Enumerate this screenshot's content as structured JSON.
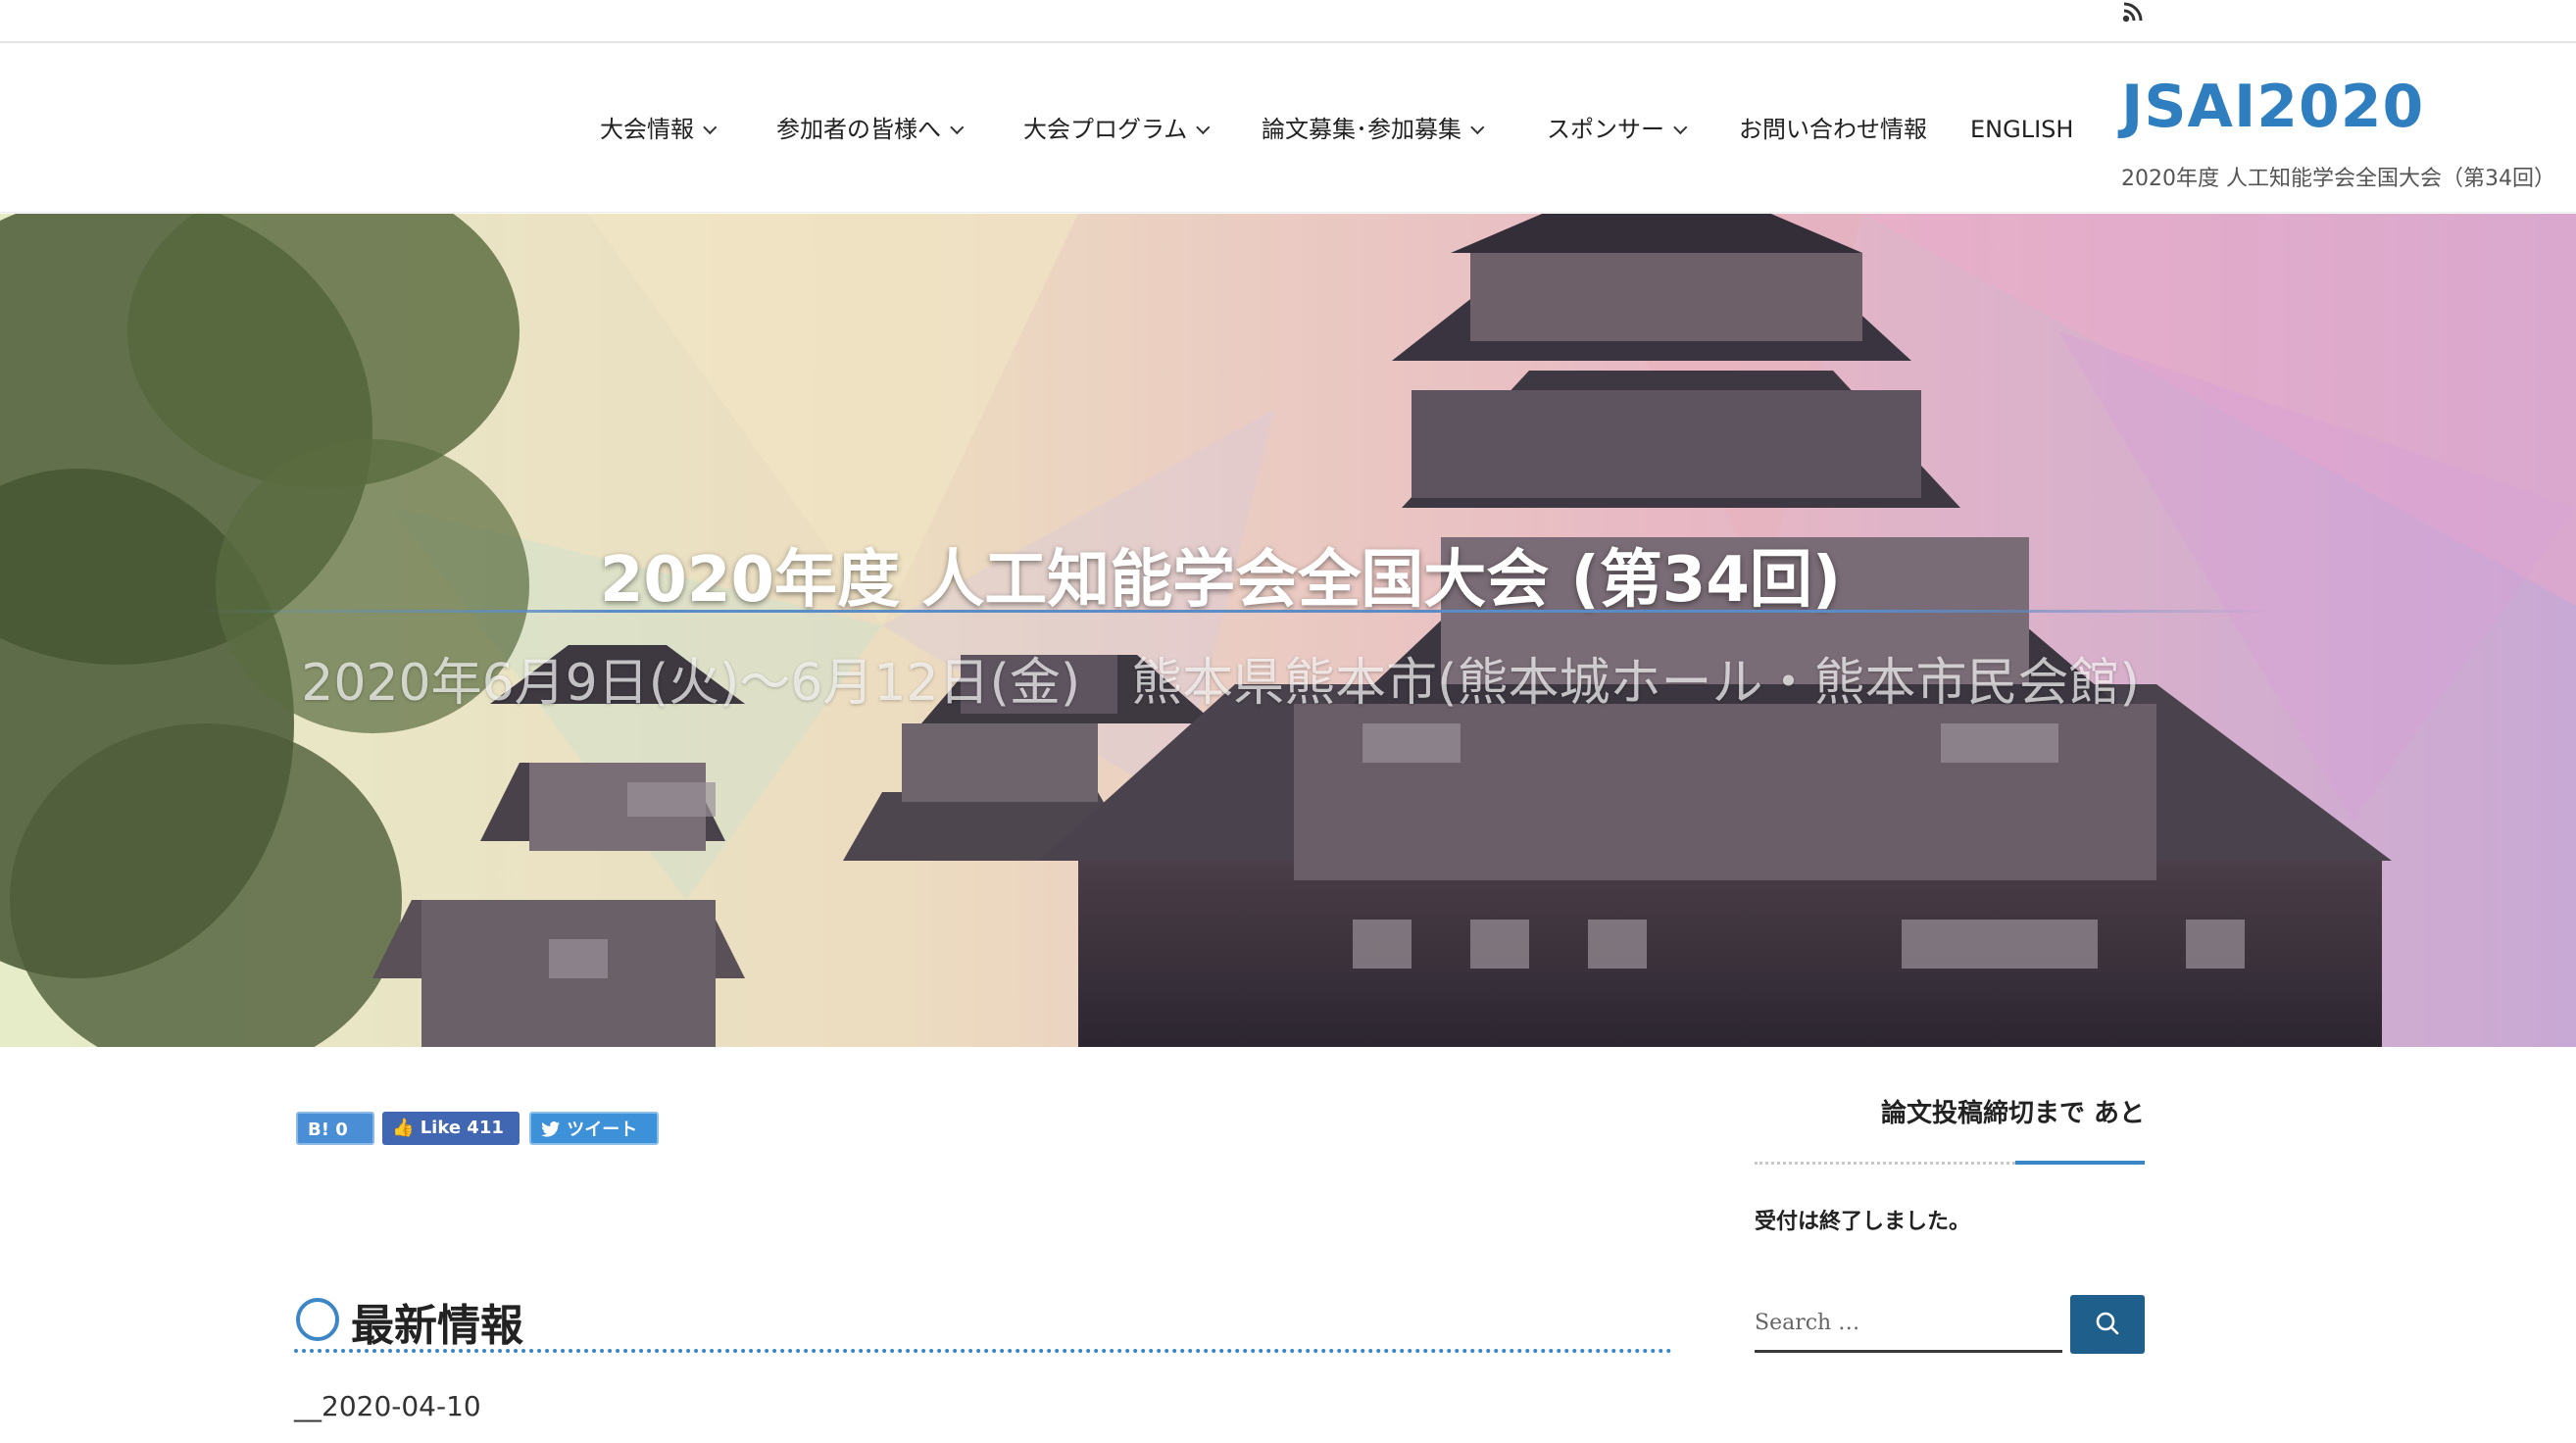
{
  "nav": {
    "items": [
      {
        "label": "大会情報",
        "dropdown": true
      },
      {
        "label": "参加者の皆様へ",
        "dropdown": true
      },
      {
        "label": "大会プログラム",
        "dropdown": true
      },
      {
        "label": "論文募集･参加募集",
        "dropdown": true
      },
      {
        "label": "スポンサー",
        "dropdown": true
      },
      {
        "label": "お問い合わせ情報",
        "dropdown": false
      },
      {
        "label": "ENGLISH",
        "dropdown": false
      }
    ]
  },
  "brand": {
    "title": "JSAI2020",
    "subtitle": "2020年度 人工知能学会全国大会（第34回）",
    "color": "#2f7fc0"
  },
  "hero": {
    "title": "2020年度 人工知能学会全国大会 (第34回)",
    "subtitle": "2020年6月9日(火)〜6月12日(金)　熊本県熊本市(熊本城ホール・熊本市民会館)"
  },
  "share": {
    "hatena_label": "B! 0",
    "facebook_label": "Like 411",
    "twitter_label": "ツイート"
  },
  "main": {
    "section_title": "最新情報",
    "post_date": "__2020-04-10"
  },
  "sidebar": {
    "countdown_title": "論文投稿締切まで あと",
    "countdown_text": "受付は終了しました。",
    "search_placeholder": "Search …"
  },
  "icons": {
    "rss": "rss-icon",
    "search": "search-icon",
    "facebook_thumb": "thumbs-up-icon",
    "twitter_bird": "twitter-icon"
  },
  "colors": {
    "accent": "#3b86c6",
    "search_button": "#1e5f8c"
  }
}
